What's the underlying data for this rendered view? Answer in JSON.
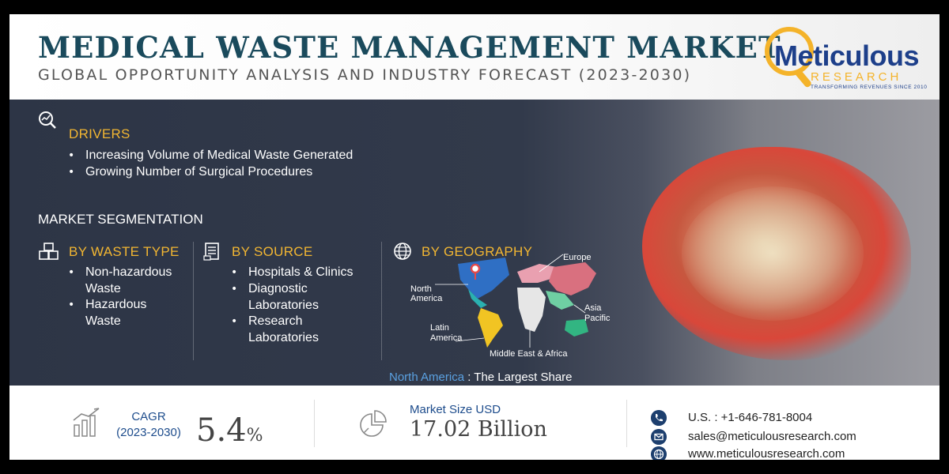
{
  "header": {
    "title": "MEDICAL WASTE MANAGEMENT MARKET",
    "subtitle": "GLOBAL OPPORTUNITY ANALYSIS AND INDUSTRY FORECAST (2023-2030)",
    "logo": {
      "name": "Meticulous",
      "research": "RESEARCH",
      "tagline": "TRANSFORMING REVENUES SINCE 2010"
    }
  },
  "drivers": {
    "heading": "DRIVERS",
    "items": [
      "Increasing Volume of Medical Waste Generated",
      "Growing Number of Surgical Procedures"
    ]
  },
  "segmentation": {
    "heading": "MARKET SEGMENTATION",
    "waste_type": {
      "heading": "BY WASTE TYPE",
      "items": [
        "Non-hazardous",
        "Waste",
        "Hazardous",
        "Waste"
      ]
    },
    "source": {
      "heading": "BY SOURCE",
      "items": [
        "Hospitals & Clinics",
        "Diagnostic",
        "Laboratories",
        "Research",
        "Laboratories"
      ]
    },
    "geography": {
      "heading": "BY GEOGRAPHY",
      "regions": {
        "europe": "Europe",
        "north_america_1": "North",
        "north_america_2": "America",
        "asia_1": "Asia",
        "asia_2": "Pacific",
        "latin_1": "Latin",
        "latin_2": "America",
        "mea": "Middle East & Africa"
      },
      "largest_region": "North America",
      "largest_text": ": The Largest Share"
    }
  },
  "footer": {
    "cagr_label": "CAGR",
    "cagr_period": "(2023-2030)",
    "cagr_value": "5.4",
    "cagr_unit": "%",
    "market_size_label": "Market Size USD",
    "market_size_value": "17.02 Billion",
    "phone": "U.S. : +1-646-781-8004",
    "email": "sales@meticulousresearch.com",
    "website": "www.meticulousresearch.com"
  },
  "colors": {
    "title": "#1a4a5c",
    "gold": "#f2b632",
    "panel": "#2d3546",
    "accent_blue": "#5aa0e0",
    "logo_blue": "#1d3f8a"
  }
}
